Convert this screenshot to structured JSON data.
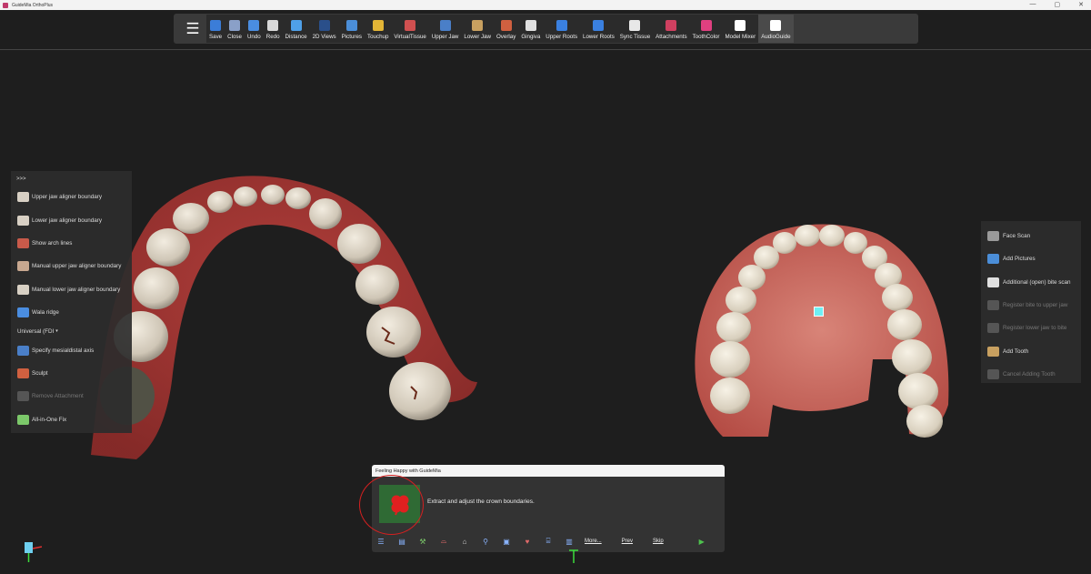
{
  "window": {
    "title": "GuideMia OrthoPlus",
    "minimize": "—",
    "maximize": "▢",
    "close": "✕"
  },
  "toolbar": {
    "menu_icon": "☰",
    "buttons": [
      {
        "label": "Save",
        "icon": "save-icon",
        "color": "#3b7dd8"
      },
      {
        "label": "Close",
        "icon": "close-doc-icon",
        "color": "#8aa0c8"
      },
      {
        "label": "Undo",
        "icon": "undo-icon",
        "color": "#4a8de0"
      },
      {
        "label": "Redo",
        "icon": "redo-icon",
        "color": "#d8d8d8"
      },
      {
        "label": "Distance",
        "icon": "ruler-icon",
        "color": "#4fa0e8"
      },
      {
        "label": "2D Views",
        "icon": "2d-views-icon",
        "color": "#2a4f8a"
      },
      {
        "label": "Pictures",
        "icon": "pictures-icon",
        "color": "#4b8ed8"
      },
      {
        "label": "Touchup",
        "icon": "touchup-icon",
        "color": "#e3b536"
      },
      {
        "label": "VirtualTissue",
        "icon": "virtual-tissue-icon",
        "color": "#d05050"
      },
      {
        "label": "Upper Jaw",
        "icon": "upper-jaw-icon",
        "color": "#4a7fc8"
      },
      {
        "label": "Lower Jaw",
        "icon": "lower-jaw-icon",
        "color": "#c8a060"
      },
      {
        "label": "Overlay",
        "icon": "overlay-icon",
        "color": "#d06040"
      },
      {
        "label": "Gingiva",
        "icon": "gingiva-icon",
        "color": "#e0e0e0"
      },
      {
        "label": "Upper Roots",
        "icon": "upper-roots-icon",
        "color": "#3a80e0"
      },
      {
        "label": "Lower Roots",
        "icon": "lower-roots-icon",
        "color": "#3a80e0"
      },
      {
        "label": "Sync Tissue",
        "icon": "sync-tissue-icon",
        "color": "#e8e8e8"
      },
      {
        "label": "Attachments",
        "icon": "attachments-icon",
        "color": "#d04060"
      },
      {
        "label": "ToothColor",
        "icon": "tooth-color-icon",
        "color": "#e04080"
      },
      {
        "label": "Model Mixer",
        "icon": "model-mixer-icon",
        "color": "#ffffff"
      },
      {
        "label": "AudioGuide",
        "icon": "audio-guide-icon",
        "color": "#ffffff"
      }
    ]
  },
  "left_panel": {
    "expand": ">>>",
    "items": [
      {
        "label": "Upper jaw aligner boundary",
        "icon": "upper-aligner-icon",
        "enabled": true
      },
      {
        "label": "Lower jaw aligner boundary",
        "icon": "lower-aligner-icon",
        "enabled": true
      },
      {
        "label": "Show arch lines",
        "icon": "arch-lines-icon",
        "enabled": true
      },
      {
        "label": "Manual upper jaw aligner boundary",
        "icon": "manual-upper-icon",
        "enabled": true
      },
      {
        "label": "Manual lower jaw aligner boundary",
        "icon": "manual-lower-icon",
        "enabled": true
      },
      {
        "label": "Wala ridge",
        "icon": "wala-ridge-icon",
        "enabled": true
      }
    ],
    "dropdown": "Universal (FDI",
    "items2": [
      {
        "label": "Specify mesialdistal axis",
        "icon": "mesiodistal-axis-icon",
        "enabled": true
      },
      {
        "label": "Sculpt",
        "icon": "sculpt-icon",
        "enabled": true
      },
      {
        "label": "Remove Attachment",
        "icon": "remove-attachment-icon",
        "enabled": false
      },
      {
        "label": "All-in-One Fix",
        "icon": "tools-icon",
        "enabled": true
      }
    ]
  },
  "right_panel": {
    "items": [
      {
        "label": "Face Scan",
        "icon": "face-scan-icon",
        "enabled": true
      },
      {
        "label": "Add Pictures",
        "icon": "add-pictures-icon",
        "enabled": true
      },
      {
        "label": "Additional (open) bite scan",
        "icon": "bite-scan-icon",
        "enabled": true
      },
      {
        "label": "Register bite to upper jaw",
        "icon": "register-upper-icon",
        "enabled": false
      },
      {
        "label": "Register lower jaw to bite",
        "icon": "register-lower-icon",
        "enabled": false
      },
      {
        "label": "Add Tooth",
        "icon": "add-tooth-icon",
        "enabled": true
      },
      {
        "label": "Cancel Adding Tooth",
        "icon": "cancel-tooth-icon",
        "enabled": false
      }
    ]
  },
  "guide": {
    "title": "Feeling Happy with GuideMia",
    "message": "Extract and adjust the crown boundaries.",
    "links": {
      "more": "More...",
      "prev": "Prev",
      "skip": "Skip"
    }
  }
}
